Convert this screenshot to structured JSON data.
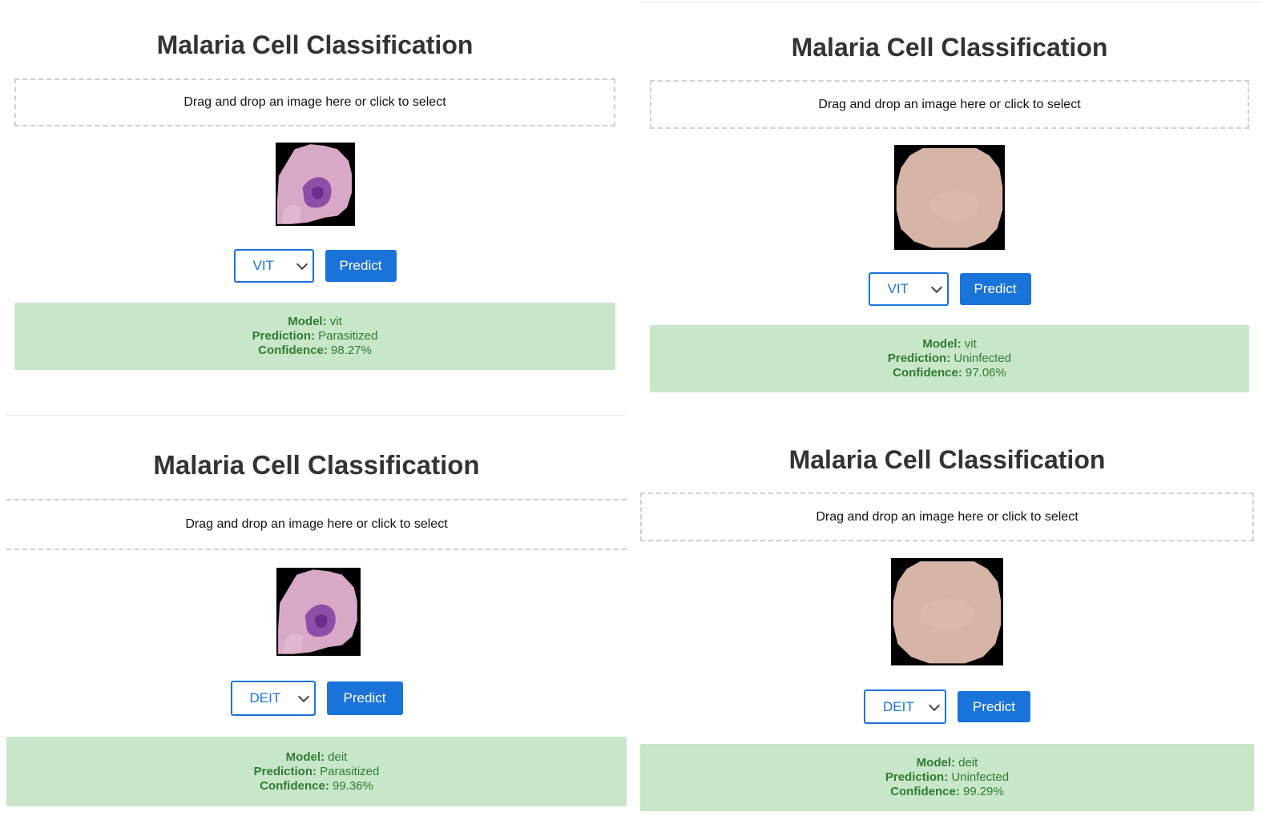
{
  "panels": [
    {
      "title": "Malaria Cell Classification",
      "dropzone_text": "Drag and drop an image here or click to select",
      "preview_image": "parasitized-cell-image",
      "selected_model": "VIT",
      "predict_label": "Predict",
      "result": {
        "model_label": "Model:",
        "model_value": "vit",
        "prediction_label": "Prediction:",
        "prediction_value": "Parasitized",
        "confidence_label": "Confidence:",
        "confidence_value": "98.27%"
      }
    },
    {
      "title": "Malaria Cell Classification",
      "dropzone_text": "Drag and drop an image here or click to select",
      "preview_image": "uninfected-cell-image",
      "selected_model": "VIT",
      "predict_label": "Predict",
      "result": {
        "model_label": "Model:",
        "model_value": "vit",
        "prediction_label": "Prediction:",
        "prediction_value": "Uninfected",
        "confidence_label": "Confidence:",
        "confidence_value": "97.06%"
      }
    },
    {
      "title": "Malaria Cell Classification",
      "dropzone_text": "Drag and drop an image here or click to select",
      "preview_image": "parasitized-cell-image",
      "selected_model": "DEIT",
      "predict_label": "Predict",
      "result": {
        "model_label": "Model:",
        "model_value": "deit",
        "prediction_label": "Prediction:",
        "prediction_value": "Parasitized",
        "confidence_label": "Confidence:",
        "confidence_value": "99.36%"
      }
    },
    {
      "title": "Malaria Cell Classification",
      "dropzone_text": "Drag and drop an image here or click to select",
      "preview_image": "uninfected-cell-image",
      "selected_model": "DEIT",
      "predict_label": "Predict",
      "result": {
        "model_label": "Model:",
        "model_value": "deit",
        "prediction_label": "Prediction:",
        "prediction_value": "Uninfected",
        "confidence_label": "Confidence:",
        "confidence_value": "99.29%"
      }
    }
  ],
  "colors": {
    "accent": "#1a73d9",
    "result_bg": "#c8e6c9",
    "result_text": "#2e7d32",
    "title": "#333333"
  }
}
